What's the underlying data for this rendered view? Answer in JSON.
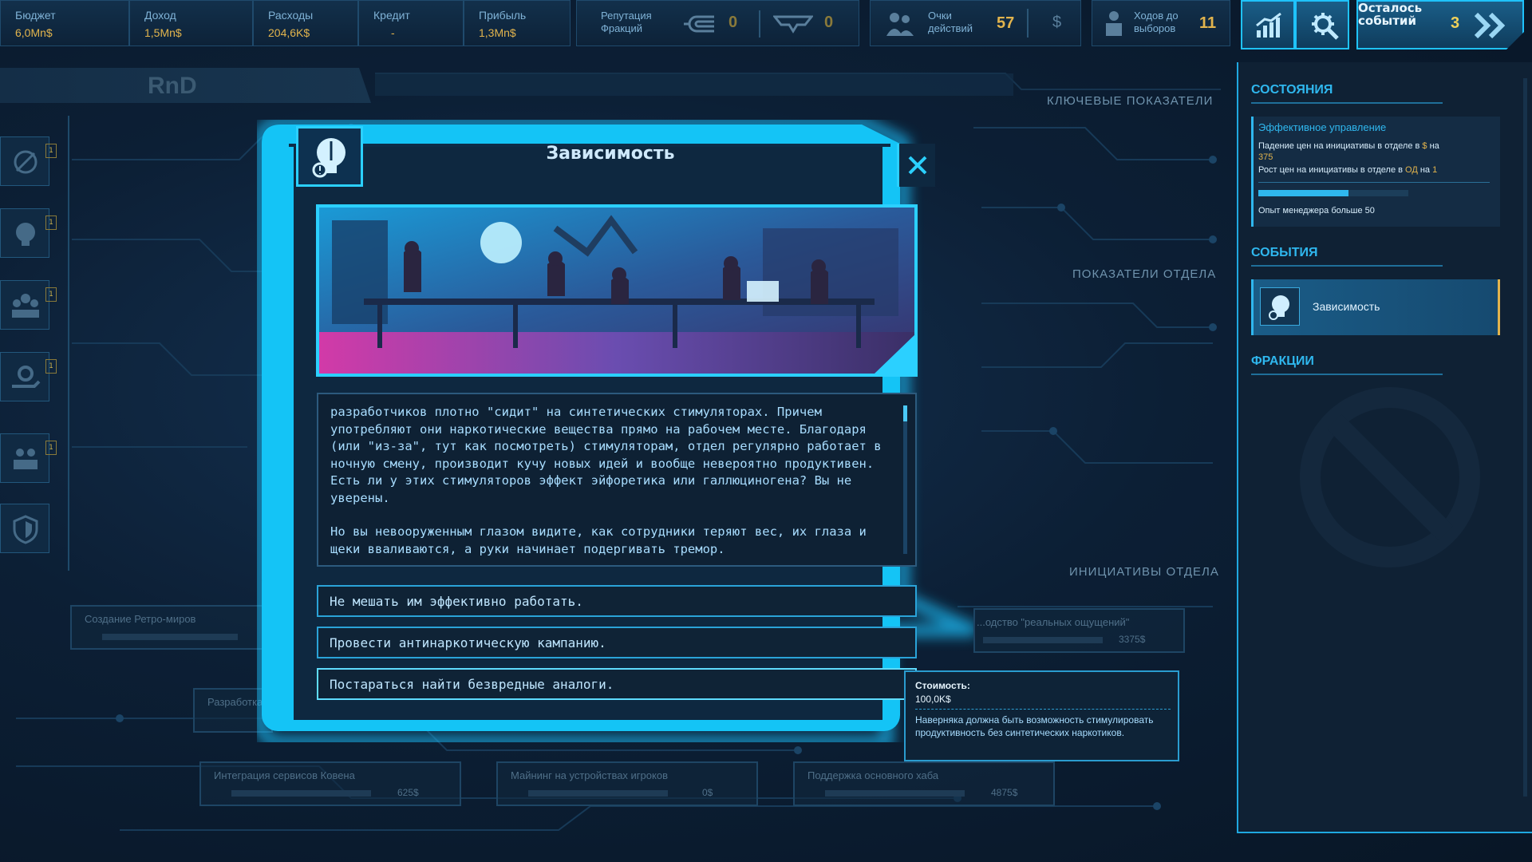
{
  "colors": {
    "accent": "#1fc3ff",
    "gold": "#e2b44d",
    "panel": "#0f2134"
  },
  "topbar": {
    "budget": {
      "label": "Бюджет",
      "value": "6,0Mn$"
    },
    "income": {
      "label": "Доход",
      "value": "1,5Mn$"
    },
    "expenses": {
      "label": "Расходы",
      "value": "204,6K$"
    },
    "credit": {
      "label": "Кредит",
      "value": "-"
    },
    "profit": {
      "label": "Прибыль",
      "value": "1,3Mn$"
    },
    "faction_rep": {
      "label_line1": "Репутация",
      "label_line2": "Фракций",
      "value1": "0",
      "value2": "0"
    },
    "action_points": {
      "label_line1": "Очки",
      "label_line2": "действий",
      "value": "57",
      "currency_icon": "$"
    },
    "turns_to_election": {
      "label_line1": "Ходов до",
      "label_line2": "выборов",
      "value": "11"
    },
    "events_left": {
      "label_line1": "Осталось",
      "label_line2": "событий",
      "value": "3"
    }
  },
  "department": {
    "title": "RnD"
  },
  "sections": {
    "key_indicators": "КЛЮЧЕВЫЕ ПОКАЗАТЕЛИ",
    "dept_indicators": "ПОКАЗАТЕЛИ ОТДЕЛА",
    "dept_initiatives": "ИНИЦИАТИВЫ ОТДЕЛА"
  },
  "left_tabs": [
    {
      "icon": "cancel-coin-icon",
      "badge": "1"
    },
    {
      "icon": "rnd-head-icon",
      "badge": "1"
    },
    {
      "icon": "team-icon",
      "badge": "1"
    },
    {
      "icon": "gear-hand-icon",
      "badge": "1"
    },
    {
      "icon": "people-icon",
      "badge": "1"
    },
    {
      "icon": "shield-icon",
      "badge": ""
    }
  ],
  "initiatives": [
    {
      "title": "Создание Ретро-миров",
      "value": ""
    },
    {
      "title": "Разработка",
      "value": ""
    },
    {
      "title": "...одство \"реальных ощущений\"",
      "value": "3375$"
    },
    {
      "title": "Интеграция сервисов Ковена",
      "value": "625$"
    },
    {
      "title": "Майнинг на устройствах игроков",
      "value": "0$"
    },
    {
      "title": "Поддержка основного хаба",
      "value": "4875$"
    }
  ],
  "right_panel": {
    "states_header": "СОСТОЯНИЯ",
    "state_title": "Эффективное управление",
    "state_line1_prefix": "Падение цен на инициативы в отделе в ",
    "state_line1_currency": "$",
    "state_line1_mid": " на",
    "state_line1_value": "375",
    "state_line2_prefix": "Рост цен на инициативы в отделе в ",
    "state_line2_currency": "ОД",
    "state_line2_mid": " на ",
    "state_line2_value": "1",
    "state_progress": 0.6,
    "state_condition": "Опыт менеджера больше 50",
    "events_header": "СОБЫТИЯ",
    "event_name": "Зависимость",
    "factions_header": "ФРАКЦИИ"
  },
  "modal": {
    "title": "Зависимость",
    "text_p1": "разработчиков плотно \"сидит\" на синтетических стимуляторах. Причем употребляют они наркотические вещества прямо на рабочем месте. Благодаря (или \"из-за\", тут как посмотреть) стимуляторам, отдел регулярно работает в ночную смену, производит кучу новых идей и вообще невероятно продуктивен. Есть ли у этих стимуляторов эффект эйфоретика или галлюциногена? Вы не уверены.",
    "text_p2": "Но вы невооруженным глазом видите, как сотрудники теряют вес, их глаза и щеки вваливаются, а руки начинает подергивать тремор.",
    "choices": [
      "Не мешать им эффективно работать.",
      "Провести антинаркотическую кампанию.",
      "Постараться найти безвредные аналоги."
    ]
  },
  "tooltip": {
    "cost_label": "Стоимость:",
    "cost_value": "100,0K$",
    "description": "Наверняка должна быть возможность стимулировать продуктивность без синтетических наркотиков."
  }
}
